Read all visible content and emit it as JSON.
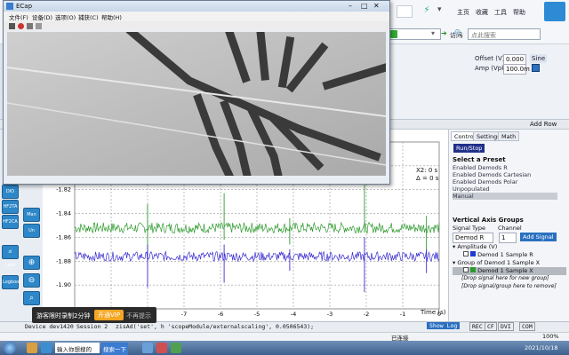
{
  "browser": {
    "nav_links": [
      "主页",
      "收藏",
      "工具",
      "帮助"
    ],
    "go_label": "访问",
    "search_placeholder": "点此搜索",
    "addr_value": ""
  },
  "settings": {
    "offset_label": "Offset (V)",
    "offset_value": "0.000",
    "amp_label": "Amp (Vpk)",
    "amp_value": "100.0m",
    "waveform_label": "Sine"
  },
  "mid_strip": {
    "add_row": "Add Row"
  },
  "video_window": {
    "title": "ECap",
    "menu": [
      "文件(F)",
      "设备(D)",
      "选项(O)",
      "捕获(C)",
      "帮助(H)"
    ]
  },
  "left_tools": [
    "DIO",
    "HF2TA",
    "HF2CA",
    "Man",
    "Un",
    "zi Labs",
    "Logbook"
  ],
  "plot": {
    "cursor_x2": "X2: 0 s",
    "cursor_delta": "Δ = 0 s",
    "x_top_tick": "-5",
    "xlabel": "Time (s)",
    "sidebar_buttons": [
      "Sub",
      "Min",
      "F"
    ]
  },
  "control_panel": {
    "tabs": [
      "Control",
      "Settings",
      "Math"
    ],
    "run_stop": "Run/Stop",
    "preset_heading": "Select a Preset",
    "presets": [
      "Enabled Demods R",
      "Enabled Demods Cartesian",
      "Enabled Demods Polar",
      "Unpopulated",
      "Manual"
    ],
    "selected_preset": "Manual",
    "axis_heading": "Vertical Axis Groups",
    "signal_type_label": "Signal Type",
    "channel_label": "Channel",
    "signal_type_value": "Demod R",
    "channel_value": "1",
    "add_signal": "Add Signal",
    "groups": [
      {
        "title": "Amplitude (V)",
        "item": "Demod 1 Sample R",
        "color": "#1f3bd6"
      },
      {
        "title": "Group of Demod 1 Sample X",
        "item": "Demod 1 Sample X",
        "color": "#2e9a2e"
      }
    ],
    "drop_new_group": "[Drop signal here for new group]",
    "drop_remove": "[Drop signal/group here to remove]"
  },
  "status": {
    "device": "Device  dev1420",
    "session": "Session  2",
    "command": "zisAd('set', h 'scopeModule/externalscaling', 0.0506543);",
    "show_log": "Show Log",
    "indicators": [
      "REC",
      "CF",
      "DVI",
      "COM"
    ]
  },
  "status2": {
    "zoom": "100%",
    "net": "已连接"
  },
  "toast": {
    "message": "游客限时录制2分钟",
    "open_vip": "开通VIP",
    "later": "不再提示"
  },
  "taskbar": {
    "start_label": "",
    "ime_placeholder": "输入你想搜的",
    "search_btn": "搜索一下",
    "datetime": "2021/10/18"
  },
  "chart_data": {
    "type": "line",
    "xlabel": "Time (s)",
    "ylabel": "",
    "xlim": [
      -10,
      0
    ],
    "ylim": [
      -1.92,
      -1.78
    ],
    "x_ticks": [
      -10,
      -9,
      -8,
      -7,
      -6,
      -5,
      -4,
      -3,
      -2,
      -1,
      0
    ],
    "x_tick_labels": [
      "-10",
      "-9",
      "-8",
      "-7",
      "-6",
      "-5",
      "-4",
      "-3",
      "-2",
      "-1",
      "0"
    ],
    "y_ticks": [
      -1.8,
      -1.82,
      -1.84,
      -1.86,
      -1.88,
      -1.9
    ],
    "y_tick_labels": [
      "-1.80",
      "-1.82",
      "-1.84",
      "-1.86",
      "-1.88",
      "-1.90"
    ],
    "grid": true,
    "series": [
      {
        "name": "Demod 1 Sample X",
        "color": "#2e9a2e",
        "baseline": -1.852,
        "noise_band": 0.0045,
        "spikes": [
          {
            "x": -8.0,
            "min": -1.875,
            "max": -1.832
          },
          {
            "x": -5.9,
            "min": -1.862,
            "max": -1.823
          },
          {
            "x": -4.1,
            "min": -1.866,
            "max": -1.844
          },
          {
            "x": -2.05,
            "min": -1.856,
            "max": -1.816
          },
          {
            "x": -0.35,
            "min": -1.874,
            "max": -1.842
          }
        ]
      },
      {
        "name": "Demod 1 Sample R",
        "color": "#3b2fd0",
        "baseline": -1.876,
        "noise_band": 0.004,
        "spikes": [
          {
            "x": -8.0,
            "min": -1.902,
            "max": -1.866
          },
          {
            "x": -5.9,
            "min": -1.898,
            "max": -1.866
          },
          {
            "x": -4.1,
            "min": -1.888,
            "max": -1.87
          },
          {
            "x": -2.05,
            "min": -1.906,
            "max": -1.86
          },
          {
            "x": -0.35,
            "min": -1.89,
            "max": -1.87
          }
        ]
      }
    ]
  }
}
